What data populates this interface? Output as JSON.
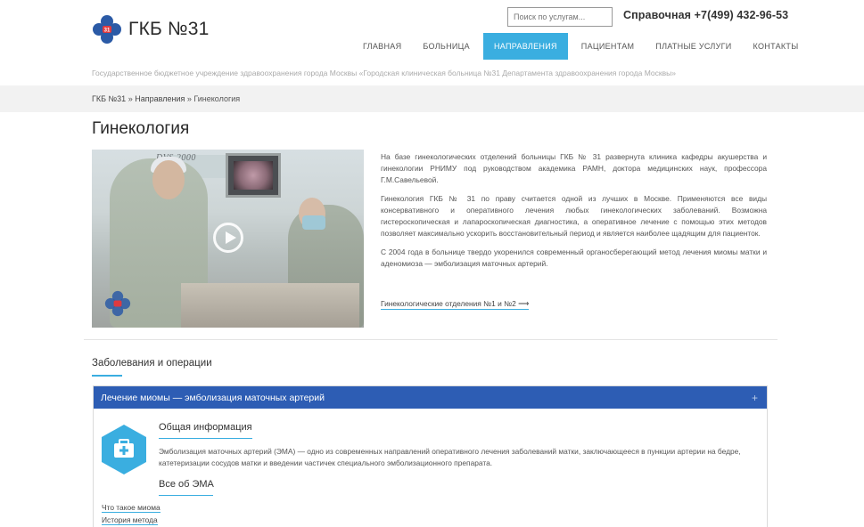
{
  "header": {
    "logo_text": "ГКБ №31",
    "search_placeholder": "Поиск по услугам...",
    "phone": "Справочная +7(499) 432-96-53",
    "org_line": "Государственное бюджетное учреждение здравоохранения города Москвы «Городская клиническая больница №31 Департамента здравоохранения города Москвы»",
    "nav": [
      "Главная",
      "Больница",
      "Направления",
      "Пациентам",
      "Платные услуги",
      "Контакты"
    ],
    "active_nav_index": 2
  },
  "breadcrumb": {
    "items": [
      "ГКБ №31",
      "Направления",
      "Гинекология"
    ],
    "separator": "»"
  },
  "page": {
    "title": "Гинекология",
    "video_caption": "DVS 2000",
    "intro": [
      "На базе гинекологических отделений больницы ГКБ № 31 развернута клиника кафедры акушерства и гинекологии РНИМУ под руководством академика РАМН, доктора медицинских наук, профессора Г.М.Савельевой.",
      "Гинекология ГКБ № 31 по праву считается одной из лучших в Москве. Применяются все виды консервативного и оперативного лечения любых гинекологических заболеваний. Возможна гистероскопическая и лапароскопическая диагностика, а оперативное лечение с помощью этих методов позволяет максимально ускорить восстановительный период и является наиболее щадящим для пациенток.",
      "С 2004 года в больнице твердо укоренился современный органосберегающий метод лечения миомы матки и аденомиоза — эмболизация маточных артерий."
    ],
    "dept_link": "Гинекологические отделения №1 и №2 ⟶"
  },
  "diseases": {
    "section_title": "Заболевания и операции",
    "accordion_title": "Лечение миомы — эмболизация маточных артерий",
    "accordion_toggle": "+",
    "block_title": "Общая информация",
    "block_text": "Эмболизация маточных артерий (ЭМА) — одно из современных направлений оперативного лечения заболеваний матки, заключающееся в пункции артерии на бедре, катетеризации сосудов матки и введении частичек специального эмболизационного препарата.",
    "sub_title": "Все об ЭМА",
    "links": [
      "Что такое миома",
      "История метода"
    ]
  },
  "colors": {
    "accent": "#3aaee0",
    "accordion_header": "#2d5db4",
    "logo_blue": "#2b5aa6",
    "logo_red": "#e03a3e"
  }
}
